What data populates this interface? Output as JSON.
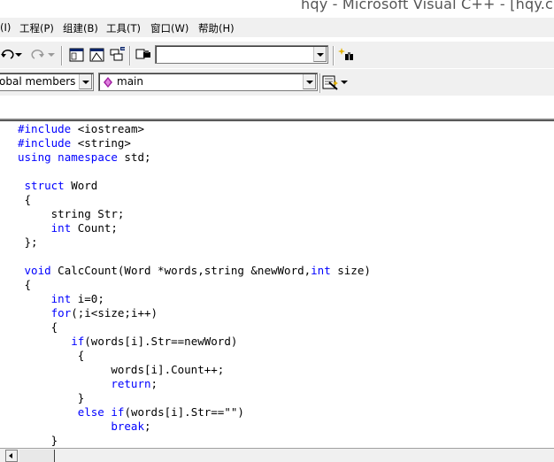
{
  "window": {
    "title": "hqy - Microsoft Visual C++ - [hqy.cpp *]"
  },
  "menubar": {
    "items": [
      {
        "label": "(I)"
      },
      {
        "label": "工程(P)"
      },
      {
        "label": "组建(B)"
      },
      {
        "label": "工具(T)"
      },
      {
        "label": "窗口(W)"
      },
      {
        "label": "帮助(H)"
      }
    ]
  },
  "toolbar": {
    "find_combo_value": "",
    "scope_combo_value": "obal members",
    "function_combo_value": "main",
    "icons": [
      "undo-icon",
      "redo-icon",
      "workspace-icon",
      "output-icon",
      "window-list-icon",
      "find-in-files-icon",
      "find-icon",
      "wizard-action-icon"
    ]
  },
  "colors": {
    "keyword": "#0000ff",
    "toolbar_bg": "#f0f0f0",
    "title_text": "#555555"
  },
  "code": {
    "lines": [
      [
        {
          "t": "#include",
          "k": true
        },
        {
          "t": " <iostream>"
        }
      ],
      [
        {
          "t": "#include",
          "k": true
        },
        {
          "t": " <string>"
        }
      ],
      [
        {
          "t": "using",
          "k": true
        },
        {
          "t": " "
        },
        {
          "t": "namespace",
          "k": true
        },
        {
          "t": " std;"
        }
      ],
      [],
      [
        {
          "t": " "
        },
        {
          "t": "struct",
          "k": true
        },
        {
          "t": " Word"
        }
      ],
      [
        {
          "t": " {"
        }
      ],
      [
        {
          "t": "     string Str;"
        }
      ],
      [
        {
          "t": "     "
        },
        {
          "t": "int",
          "k": true
        },
        {
          "t": " Count;"
        }
      ],
      [
        {
          "t": " };"
        }
      ],
      [],
      [
        {
          "t": " "
        },
        {
          "t": "void",
          "k": true
        },
        {
          "t": " CalcCount(Word *words,string &newWord,"
        },
        {
          "t": "int",
          "k": true
        },
        {
          "t": " size)"
        }
      ],
      [
        {
          "t": " {"
        }
      ],
      [
        {
          "t": "     "
        },
        {
          "t": "int",
          "k": true
        },
        {
          "t": " i=0;"
        }
      ],
      [
        {
          "t": "     "
        },
        {
          "t": "for",
          "k": true
        },
        {
          "t": "(;i<size;i++)"
        }
      ],
      [
        {
          "t": "     {"
        }
      ],
      [
        {
          "t": "        "
        },
        {
          "t": "if",
          "k": true
        },
        {
          "t": "(words[i].Str==newWord)"
        }
      ],
      [
        {
          "t": "         {"
        }
      ],
      [
        {
          "t": "              words[i].Count++;"
        }
      ],
      [
        {
          "t": "              "
        },
        {
          "t": "return",
          "k": true
        },
        {
          "t": ";"
        }
      ],
      [
        {
          "t": "         }"
        }
      ],
      [
        {
          "t": "         "
        },
        {
          "t": "else",
          "k": true
        },
        {
          "t": " "
        },
        {
          "t": "if",
          "k": true
        },
        {
          "t": "(words[i].Str==\"\")"
        }
      ],
      [
        {
          "t": "              "
        },
        {
          "t": "break",
          "k": true
        },
        {
          "t": ";"
        }
      ],
      [
        {
          "t": "     }"
        }
      ]
    ]
  }
}
